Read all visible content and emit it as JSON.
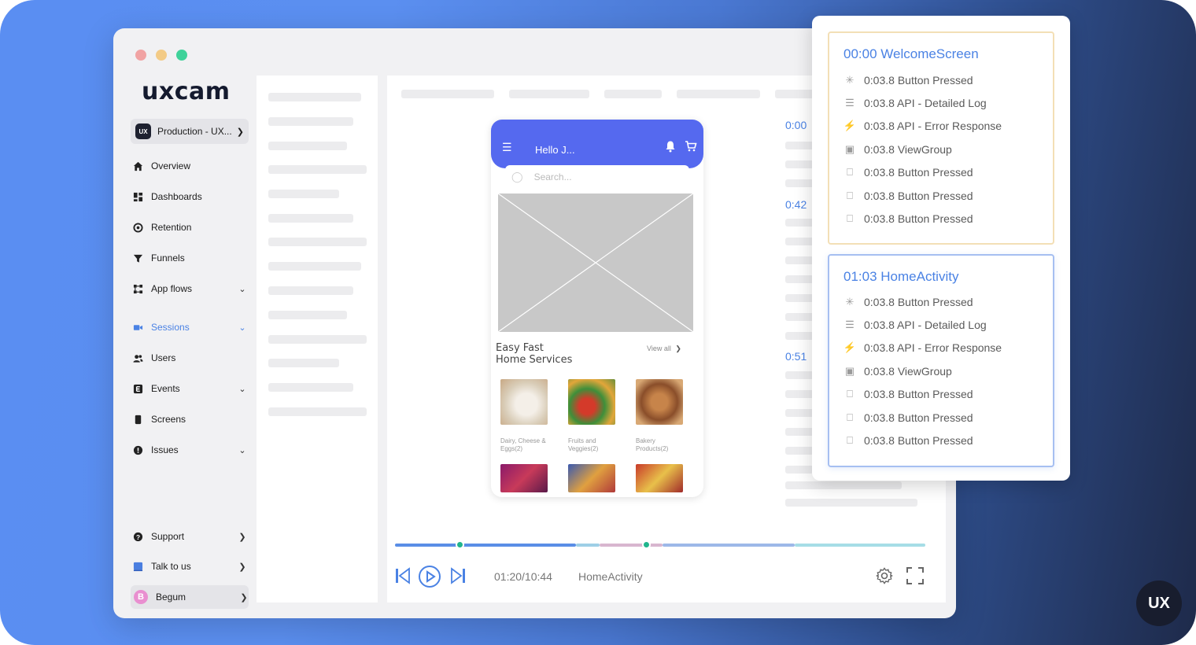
{
  "app": {
    "logo": "uxcam",
    "project": "Production - UX..."
  },
  "sidebar": {
    "items": [
      {
        "label": "Overview",
        "icon": "home-icon"
      },
      {
        "label": "Dashboards",
        "icon": "dashboard-icon"
      },
      {
        "label": "Retention",
        "icon": "retention-icon"
      },
      {
        "label": "Funnels",
        "icon": "funnel-icon"
      },
      {
        "label": "App flows",
        "icon": "flows-icon"
      },
      {
        "label": "Sessions",
        "icon": "video-icon"
      },
      {
        "label": "Users",
        "icon": "users-icon"
      },
      {
        "label": "Events",
        "icon": "events-icon"
      },
      {
        "label": "Screens",
        "icon": "screens-icon"
      },
      {
        "label": "Issues",
        "icon": "alert-icon"
      }
    ],
    "footer": [
      {
        "label": "Support",
        "icon": "help-icon"
      },
      {
        "label": "Talk to us",
        "icon": "chat-icon"
      }
    ],
    "user": {
      "name": "Begum",
      "initial": "B"
    }
  },
  "phone": {
    "greeting": "Hello J...",
    "search_placeholder": "Search...",
    "section_title_1": "Easy Fast",
    "section_title_2": "Home Services",
    "view_all": "View all",
    "products": [
      {
        "caption_1": "Dairy, Cheese &",
        "caption_2": "Eggs(2)"
      },
      {
        "caption_1": "Fruits and",
        "caption_2": "Veggies(2)"
      },
      {
        "caption_1": "Bakery",
        "caption_2": "Products(2)"
      }
    ]
  },
  "timeline": {
    "stamps": [
      "0:00",
      "0:42",
      "0:51"
    ]
  },
  "player": {
    "progress_fraction": 0.122,
    "time": "01:20/10:44",
    "screen": "HomeActivity"
  },
  "popup": {
    "cards": [
      {
        "title": "00:00 WelcomeScreen",
        "events": [
          {
            "label": "0:03.8 Button Pressed",
            "icon": "tap-icon"
          },
          {
            "label": "0:03.8 API - Detailed Log",
            "icon": "log-icon"
          },
          {
            "label": "0:03.8 API - Error Response",
            "icon": "bolt-icon"
          },
          {
            "label": "0:03.8 ViewGroup",
            "icon": "viewgroup-icon"
          },
          {
            "label": "0:03.8 Button Pressed",
            "icon": "pointer-icon"
          },
          {
            "label": "0:03.8 Button Pressed",
            "icon": "pointer-icon"
          },
          {
            "label": "0:03.8 Button Pressed",
            "icon": "pointer-icon"
          }
        ]
      },
      {
        "title": "01:03 HomeActivity",
        "events": [
          {
            "label": "0:03.8 Button Pressed",
            "icon": "tap-icon"
          },
          {
            "label": "0:03.8 API - Detailed Log",
            "icon": "log-icon"
          },
          {
            "label": "0:03.8 API - Error Response",
            "icon": "bolt-icon"
          },
          {
            "label": "0:03.8 ViewGroup",
            "icon": "viewgroup-icon"
          },
          {
            "label": "0:03.8 Button Pressed",
            "icon": "pointer-icon"
          },
          {
            "label": "0:03.8 Button Pressed",
            "icon": "pointer-icon"
          },
          {
            "label": "0:03.8 Button Pressed",
            "icon": "pointer-icon"
          }
        ]
      }
    ]
  },
  "badge": "UX"
}
